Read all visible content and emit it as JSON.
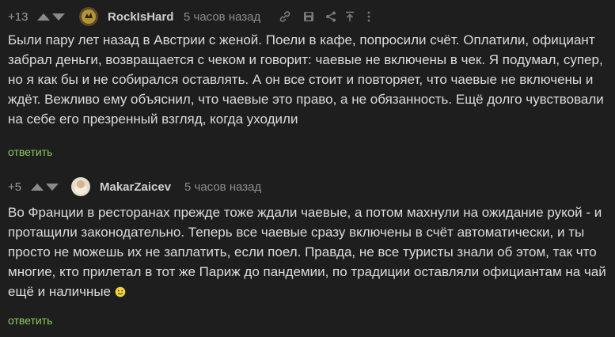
{
  "comments": [
    {
      "score": "+13",
      "author": "RockIsHard",
      "time": "5 часов назад",
      "text": "Были пару лет назад в Австрии с женой. Поели в кафе, попросили счёт. Оплатили, официант забрал деньги, возвращается с чеком и говорит: чаевые не включены в чек. Я подумал, супер, но я как бы и не собирался оставлять. А он все стоит и повторяет, что чаевые не включены и ждёт. Вежливо ему объяснил, что чаевые это право, а не обязанность. Ещё долго чувствовали на себе его презренный взгляд, когда уходили",
      "reply_label": "ответить",
      "tools": [
        "link-icon",
        "save-icon",
        "share-icon",
        "scroll-up-icon",
        "more-icon"
      ]
    },
    {
      "score": "+5",
      "author": "MakarZaicev",
      "time": "5 часов назад",
      "text": "Во Франции в ресторанах прежде тоже ждали чаевые, а потом махнули на ожидание рукой - и протащили законодательно. Теперь все чаевые сразу включены в счёт автоматически, и ты просто не можешь их не заплатить, если поел. Правда, не все туристы знали об этом, так что многие, кто прилетал в тот же Париж до пандемии, по традиции оставляли официантам на чай ещё и наличные",
      "emoji": "smiley-icon",
      "reply_label": "ответить"
    }
  ],
  "colors": {
    "background": "#1e1e1e",
    "reply": "#8ac858",
    "muted": "#8c8c8c"
  }
}
